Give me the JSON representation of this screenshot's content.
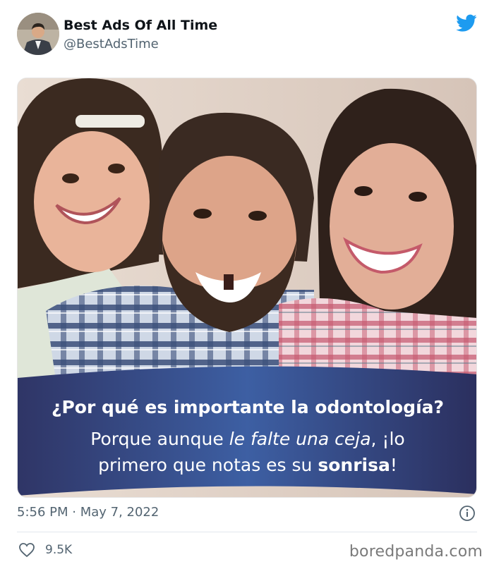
{
  "tweet": {
    "display_name": "Best Ads Of All Time",
    "handle": "@BestAdsTime",
    "timestamp": "5:56 PM · May 7, 2022",
    "likes": "9.5K",
    "avatar_icon": "man-in-suit-avatar",
    "brand_icon": "twitter-bird-icon",
    "brand_color": "#1d9bf0"
  },
  "ad": {
    "question": "¿Por qué es importante la odontología?",
    "answer_part1": "Porque aunque ",
    "answer_italic": "le falte una ceja",
    "answer_part2": ", ¡lo",
    "answer_line2_start": "primero que notas es su ",
    "answer_bold": "sonrisa",
    "answer_end": "!",
    "banner_color": "#3a3f73"
  },
  "footer": {
    "watermark": "boredpanda.com"
  }
}
